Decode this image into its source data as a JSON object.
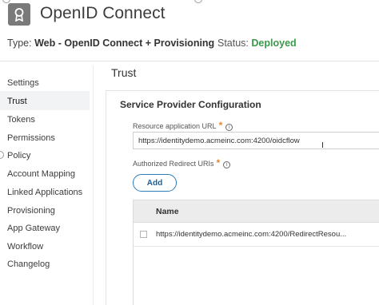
{
  "app": {
    "icon": "badge-icon",
    "title": "OpenID Connect",
    "type_label": "Type:",
    "type_value": "Web - OpenID Connect + Provisioning",
    "status_label": "Status:",
    "status_value": "Deployed",
    "status_color": "#3a9a4a"
  },
  "sidebar": {
    "items": [
      {
        "label": "Settings"
      },
      {
        "label": "Trust"
      },
      {
        "label": "Tokens"
      },
      {
        "label": "Permissions"
      },
      {
        "label": "Policy"
      },
      {
        "label": "Account Mapping"
      },
      {
        "label": "Linked Applications"
      },
      {
        "label": "Provisioning"
      },
      {
        "label": "App Gateway"
      },
      {
        "label": "Workflow"
      },
      {
        "label": "Changelog"
      }
    ],
    "active": "Trust"
  },
  "main": {
    "section_title": "Trust",
    "card_title": "Service Provider Configuration",
    "resource_url": {
      "label": "Resource application URL",
      "required_mark": "*",
      "info_icon": "info-icon",
      "value": "https://identitydemo.acmeinc.com:4200/oidcflow"
    },
    "redirect_uris": {
      "label": "Authorized Redirect URIs",
      "required_mark": "*",
      "info_icon": "info-icon",
      "add_button": "Add",
      "column_name": "Name",
      "rows": [
        {
          "value": "https://identitydemo.acmeinc.com:4200/RedirectResou..."
        }
      ]
    }
  },
  "colors": {
    "accent": "#2b7bb8",
    "required": "#e8872b"
  }
}
